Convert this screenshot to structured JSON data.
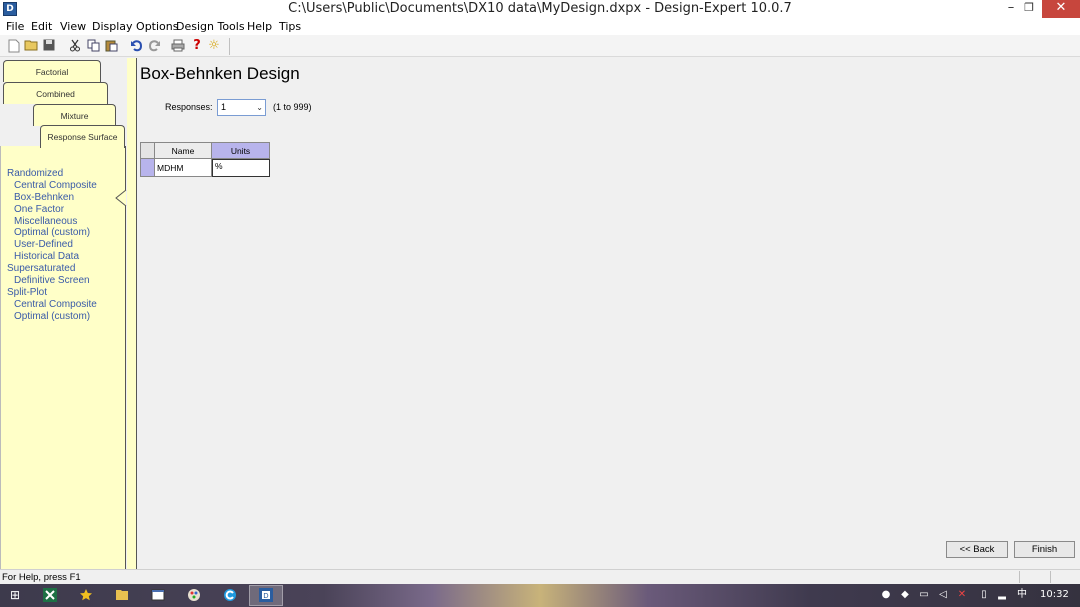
{
  "window": {
    "title": "C:\\Users\\Public\\Documents\\DX10 data\\MyDesign.dxpx - Design-Expert 10.0.7",
    "icon_label": "D",
    "min": "–",
    "restore": "❐",
    "close": "✕"
  },
  "menu": [
    "File",
    "Edit",
    "View",
    "Display Options",
    "Design Tools",
    "Help",
    "Tips"
  ],
  "toolbar": {
    "icons": [
      "new-icon",
      "open-icon",
      "save-icon",
      "cut-icon",
      "copy-icon",
      "paste-icon",
      "undo-icon",
      "redo-icon",
      "print-icon",
      "help-icon",
      "tip-icon"
    ],
    "help_glyph": "?",
    "tip_glyph": "☼"
  },
  "tabs": {
    "factorial": "Factorial",
    "combined": "Combined",
    "mixture": "Mixture",
    "response_surface": "Response Surface"
  },
  "design_list": [
    {
      "label": "Randomized",
      "group": true
    },
    {
      "label": "Central Composite",
      "group": false
    },
    {
      "label": "Box-Behnken",
      "group": false
    },
    {
      "label": "One Factor",
      "group": false
    },
    {
      "label": "Miscellaneous",
      "group": false
    },
    {
      "label": "Optimal (custom)",
      "group": false
    },
    {
      "label": "User-Defined",
      "group": false
    },
    {
      "label": "Historical Data",
      "group": false
    },
    {
      "label": "Supersaturated",
      "group": true
    },
    {
      "label": "Definitive Screen",
      "group": false
    },
    {
      "label": "Split-Plot",
      "group": true
    },
    {
      "label": "Central Composite",
      "group": false
    },
    {
      "label": "Optimal (custom)",
      "group": false
    }
  ],
  "main": {
    "title": "Box-Behnken Design",
    "responses_label": "Responses:",
    "responses_value": "1",
    "responses_range": "(1 to 999)",
    "grid": {
      "headers": {
        "name": "Name",
        "units": "Units"
      },
      "rows": [
        {
          "name": "MDHM",
          "units": "%"
        }
      ]
    },
    "back_label": "<< Back",
    "finish_label": "Finish"
  },
  "status": {
    "text": "For Help, press F1"
  },
  "taskbar": {
    "start_glyph": "⊞",
    "apps": [
      "excel-icon",
      "star-icon",
      "file-explorer-icon",
      "window-icon",
      "paint-icon",
      "browser-icon",
      "design-expert-icon"
    ],
    "clock": "10:32",
    "ime": "中"
  },
  "colors": {
    "panel_yellow": "#ffffc8",
    "header_purple": "#b8b4ec",
    "list_blue": "#3a5ba8",
    "close_red": "#c7463d"
  }
}
